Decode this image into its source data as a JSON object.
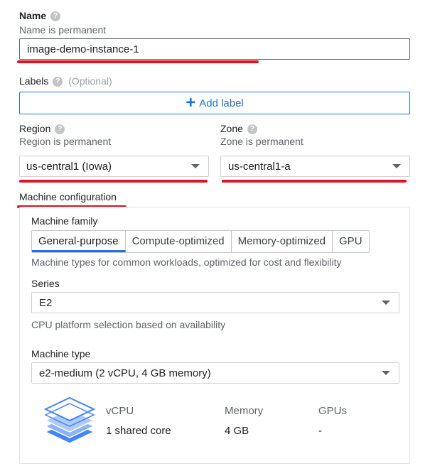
{
  "name": {
    "label": "Name",
    "hint": "Name is permanent",
    "value": "image-demo-instance-1"
  },
  "labels": {
    "label": "Labels",
    "optional": "(Optional)",
    "add_button": "Add label"
  },
  "region": {
    "label": "Region",
    "hint": "Region is permanent",
    "value": "us-central1 (Iowa)"
  },
  "zone": {
    "label": "Zone",
    "hint": "Zone is permanent",
    "value": "us-central1-a"
  },
  "machine_config": {
    "title": "Machine configuration",
    "family_label": "Machine family",
    "tabs": [
      "General-purpose",
      "Compute-optimized",
      "Memory-optimized",
      "GPU"
    ],
    "active_tab": "General-purpose",
    "family_description": "Machine types for common workloads, optimized for cost and flexibility",
    "series_label": "Series",
    "series_value": "E2",
    "series_hint": "CPU platform selection based on availability",
    "type_label": "Machine type",
    "type_value": "e2-medium (2 vCPU, 4 GB memory)",
    "specs": {
      "vcpu_header": "vCPU",
      "vcpu_value": "1 shared core",
      "memory_header": "Memory",
      "memory_value": "4 GB",
      "gpus_header": "GPUs",
      "gpus_value": "-"
    }
  },
  "icons": {
    "help": "help-circle-icon",
    "dropdown": "chevron-down-icon",
    "add": "plus-icon",
    "machine": "stacked-layers-icon"
  },
  "colors": {
    "accent": "#1a73e8",
    "annotation": "#e0141e"
  }
}
